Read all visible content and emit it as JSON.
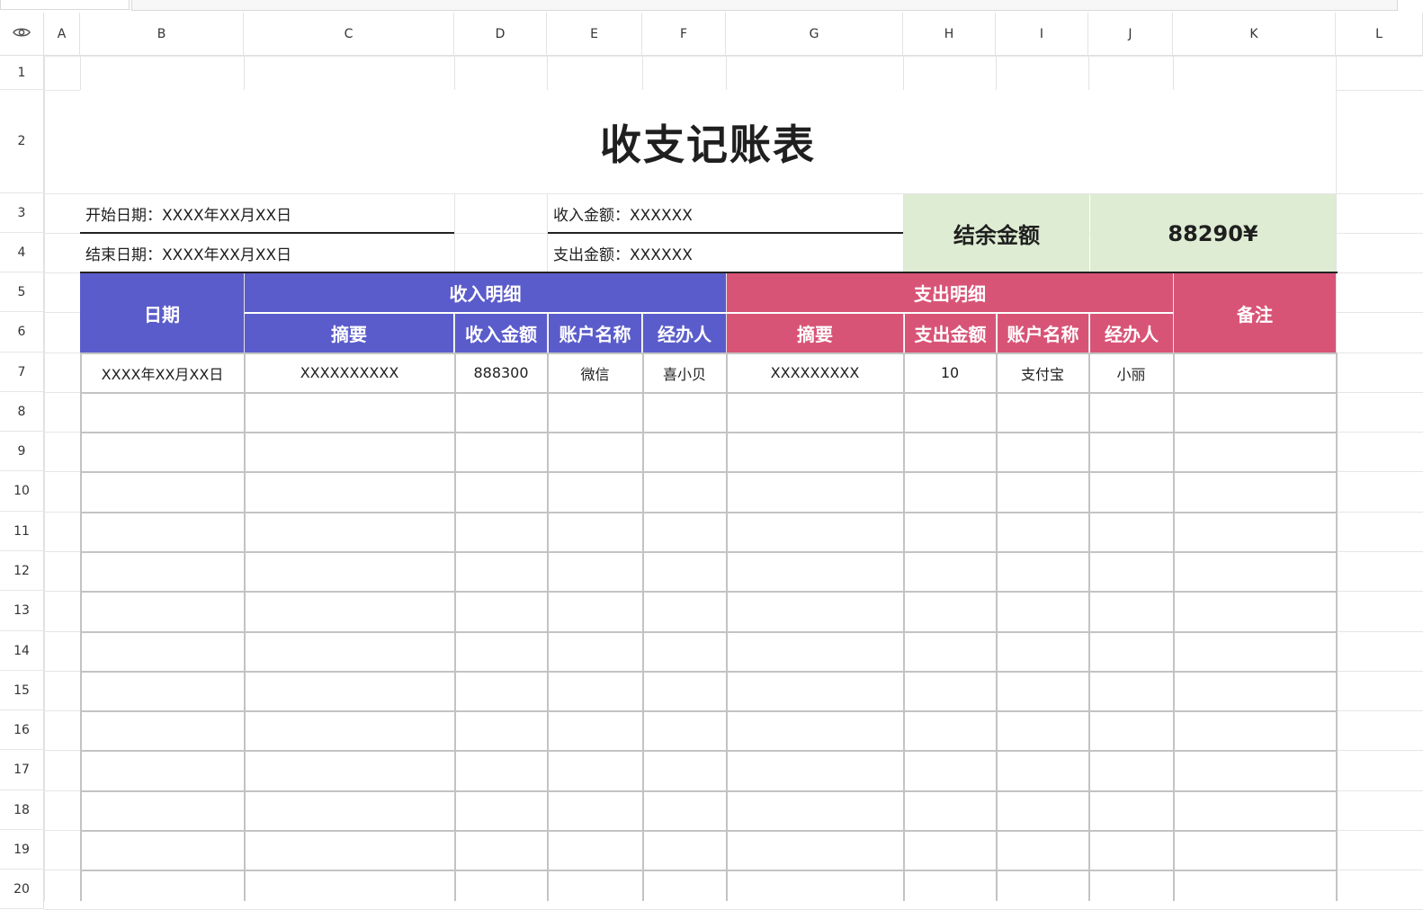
{
  "sheet": {
    "columns": [
      "A",
      "B",
      "C",
      "D",
      "E",
      "F",
      "G",
      "H",
      "I",
      "J",
      "K",
      "L"
    ],
    "rows": [
      "1",
      "2",
      "3",
      "4",
      "5",
      "6",
      "7",
      "8",
      "9",
      "10",
      "11",
      "12",
      "13",
      "14",
      "15",
      "16",
      "17",
      "18",
      "19",
      "20"
    ]
  },
  "doc": {
    "title": "收支记账表",
    "start_date": "开始日期：XXXX年XX月XX日",
    "end_date": "结束日期：XXXX年XX月XX日",
    "income_amount": "收入金额：XXXXXX",
    "expense_amount": "支出金额：XXXXXX",
    "balance_label": "结余金额",
    "balance_value": "88290¥"
  },
  "table": {
    "date_header": "日期",
    "income_group": "收入明细",
    "expense_group": "支出明细",
    "remark_header": "备注",
    "income_cols": [
      "摘要",
      "收入金额",
      "账户名称",
      "经办人"
    ],
    "expense_cols": [
      "摘要",
      "支出金额",
      "账户名称",
      "经办人"
    ],
    "rows": [
      [
        "XXXX年XX月XX日",
        "XXXXXXXXXX",
        "888300",
        "微信",
        "喜小贝",
        "XXXXXXXXX",
        "10",
        "支付宝",
        "小丽",
        ""
      ]
    ]
  },
  "colors": {
    "income_header": "#5b5ccb",
    "expense_header": "#d85476",
    "balance_bg": "#deecd3"
  },
  "icons": {
    "corner": "eye-icon"
  }
}
